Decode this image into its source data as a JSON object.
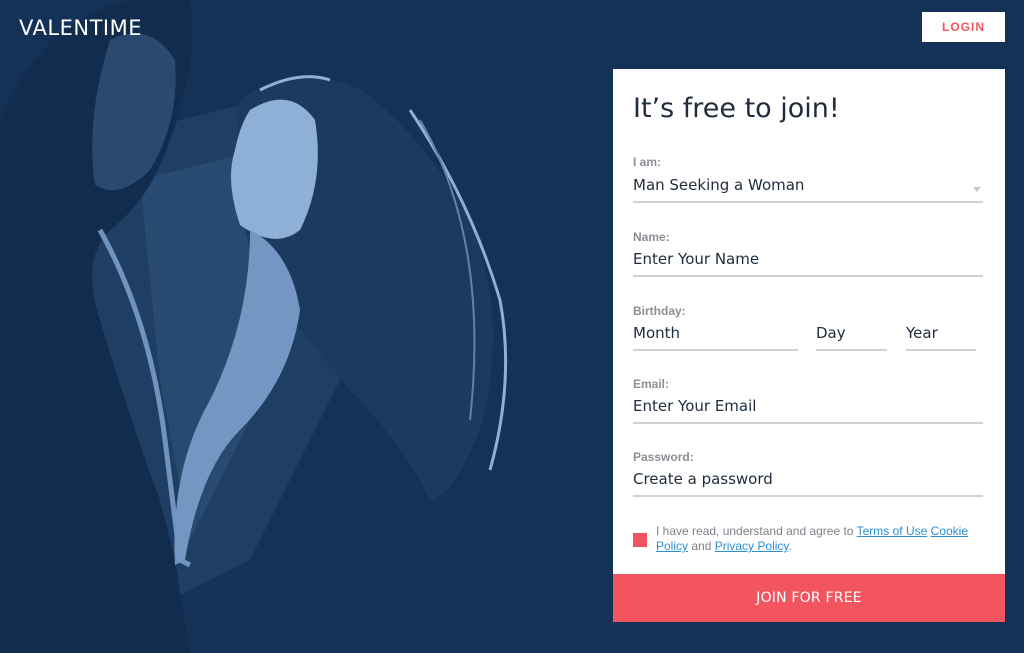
{
  "header": {
    "logo": "VALENTIME",
    "login_label": "LOGIN"
  },
  "form": {
    "title": "It’s free to join!",
    "iam": {
      "label": "I am:",
      "value": "Man Seeking a Woman"
    },
    "name": {
      "label": "Name:",
      "placeholder": "Enter Your Name"
    },
    "birthday": {
      "label": "Birthday:",
      "month_placeholder": "Month",
      "day_placeholder": "Day",
      "year_placeholder": "Year"
    },
    "email": {
      "label": "Email:",
      "placeholder": "Enter Your Email"
    },
    "password": {
      "label": "Password:",
      "placeholder": "Create a password"
    },
    "terms": {
      "prefix": "I have read, understand and agree to ",
      "terms_link": "Terms of Use",
      "cookie_link": "Cookie Policy",
      "and": " and ",
      "privacy_link": "Privacy Policy",
      "suffix": "."
    },
    "submit_label": "JOIN FOR FREE"
  },
  "colors": {
    "background": "#143257",
    "accent": "#f2555f",
    "link": "#2a8fd6"
  }
}
